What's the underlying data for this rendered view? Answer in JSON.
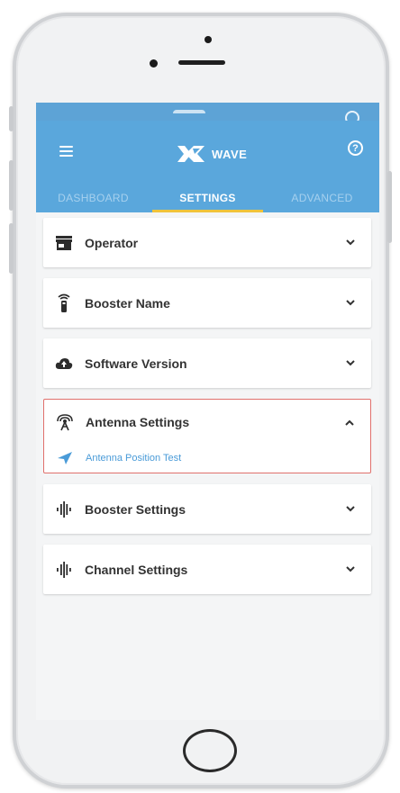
{
  "app": {
    "logo_text": "WAVE"
  },
  "tabs": [
    {
      "label": "DASHBOARD",
      "active": false
    },
    {
      "label": "SETTINGS",
      "active": true
    },
    {
      "label": "ADVANCED",
      "active": false
    }
  ],
  "settings": [
    {
      "label": "Operator",
      "icon": "store-icon",
      "expanded": false
    },
    {
      "label": "Booster Name",
      "icon": "remote-icon",
      "expanded": false
    },
    {
      "label": "Software Version",
      "icon": "cloud-upload-icon",
      "expanded": false
    },
    {
      "label": "Antenna Settings",
      "icon": "antenna-icon",
      "expanded": true,
      "children": [
        {
          "label": "Antenna Position Test",
          "icon": "navigation-arrow-icon"
        }
      ]
    },
    {
      "label": "Booster Settings",
      "icon": "signal-bars-icon",
      "expanded": false
    },
    {
      "label": "Channel Settings",
      "icon": "signal-bars-icon",
      "expanded": false
    }
  ],
  "colors": {
    "header": "#5aa7dc",
    "active_tab_underline": "#f0c33a",
    "expanded_border": "#e0706c",
    "link": "#4a9bd8"
  }
}
